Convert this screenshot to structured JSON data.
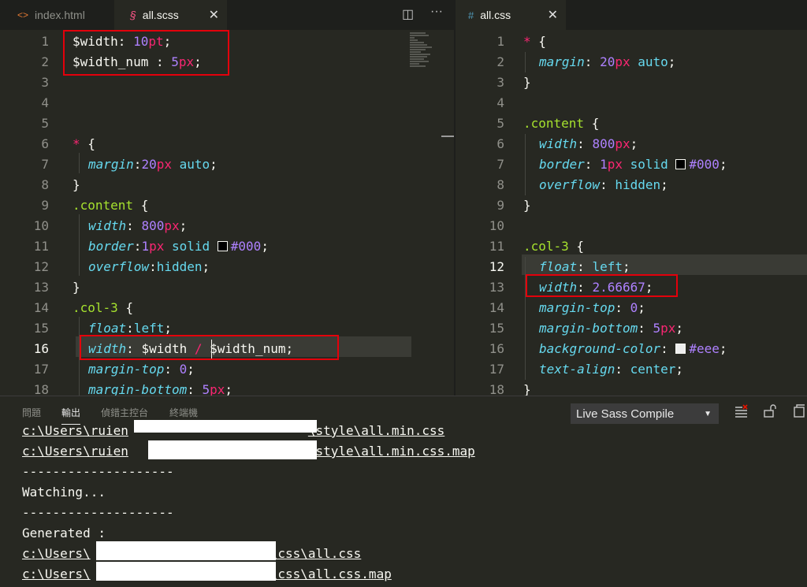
{
  "tabs_left": [
    {
      "icon": "<>",
      "label": "index.html"
    },
    {
      "icon": "§",
      "label": "all.scss",
      "close": "✕"
    }
  ],
  "tabs_right": [
    {
      "icon": "#",
      "label": "all.css",
      "close": "✕"
    }
  ],
  "toolbar": {
    "split_icon": "◫",
    "more_icon": "···"
  },
  "scss_lines": [
    "1",
    "2",
    "3",
    "4",
    "5",
    "6",
    "7",
    "8",
    "9",
    "10",
    "11",
    "12",
    "13",
    "14",
    "15",
    "16",
    "17",
    "18"
  ],
  "scss": {
    "l1": {
      "var": "$width",
      "sep": ": ",
      "num": "10",
      "unit": "pt",
      "end": ";"
    },
    "l2": {
      "var": "$width_num",
      "sep": " : ",
      "num": "5",
      "unit": "px",
      "end": ";"
    },
    "l6": {
      "sel": "*",
      "rest": " {"
    },
    "l7": {
      "prop": "margin",
      "colon": ":",
      "num": "20",
      "unit": "px",
      "val": " auto",
      "end": ";"
    },
    "l8": {
      "text": "}"
    },
    "l9": {
      "cls": ".content",
      "rest": " {"
    },
    "l10": {
      "prop": "width",
      "colon": ": ",
      "num": "800",
      "unit": "px",
      "end": ";"
    },
    "l11": {
      "prop": "border",
      "colon": ":",
      "num": "1",
      "unit": "px",
      "val": " solid ",
      "color": "#000",
      "end": ";"
    },
    "l12": {
      "prop": "overflow",
      "colon": ":",
      "val": "hidden",
      "end": ";"
    },
    "l13": {
      "text": "}"
    },
    "l14": {
      "cls": ".col-3",
      "rest": " {"
    },
    "l15": {
      "prop": "float",
      "colon": ":",
      "val": "left",
      "end": ";"
    },
    "l16": {
      "prop": "width",
      "colon": ": ",
      "var1": "$width",
      "op": " / ",
      "var2": "$width_num",
      "end": ";"
    },
    "l17": {
      "prop": "margin-top",
      "colon": ": ",
      "num": "0",
      "end": ";"
    },
    "l18": {
      "prop": "margin-bottom",
      "colon": ": ",
      "num": "5",
      "unit": "px",
      "end": ";"
    }
  },
  "css_lines": [
    "1",
    "2",
    "3",
    "4",
    "5",
    "6",
    "7",
    "8",
    "9",
    "10",
    "11",
    "12",
    "13",
    "14",
    "15",
    "16",
    "17",
    "18"
  ],
  "css": {
    "l1": {
      "sel": "*",
      "rest": " {"
    },
    "l2": {
      "prop": "margin",
      "colon": ": ",
      "num": "20",
      "unit": "px",
      "val": " auto",
      "end": ";"
    },
    "l3": {
      "text": "}"
    },
    "l5": {
      "cls": ".content",
      "rest": " {"
    },
    "l6": {
      "prop": "width",
      "colon": ": ",
      "num": "800",
      "unit": "px",
      "end": ";"
    },
    "l7": {
      "prop": "border",
      "colon": ": ",
      "num": "1",
      "unit": "px",
      "val": " solid ",
      "color": "#000",
      "end": ";"
    },
    "l8": {
      "prop": "overflow",
      "colon": ": ",
      "val": "hidden",
      "end": ";"
    },
    "l9": {
      "text": "}"
    },
    "l11": {
      "cls": ".col-3",
      "rest": " {"
    },
    "l12": {
      "prop": "float",
      "colon": ": ",
      "val": "left",
      "end": ";"
    },
    "l13": {
      "prop": "width",
      "colon": ": ",
      "num": "2.66667",
      "end": ";"
    },
    "l14": {
      "prop": "margin-top",
      "colon": ": ",
      "num": "0",
      "end": ";"
    },
    "l15": {
      "prop": "margin-bottom",
      "colon": ": ",
      "num": "5",
      "unit": "px",
      "end": ";"
    },
    "l16": {
      "prop": "background-color",
      "colon": ": ",
      "color": "#eee",
      "end": ";"
    },
    "l17": {
      "prop": "text-align",
      "colon": ": ",
      "val": "center",
      "end": ";"
    },
    "l18": {
      "text": "}"
    }
  },
  "panel": {
    "tabs": [
      "問題",
      "輸出",
      "偵錯主控台",
      "終端機"
    ],
    "dropdown_value": "Live Sass Compile",
    "dropdown_arrow": "▼",
    "output": [
      {
        "pre": "c:\\Users\\ruien",
        "post": "\\style\\all.min.css"
      },
      {
        "pre": "c:\\Users\\ruien",
        "post": "\\style\\all.min.css.map"
      },
      {
        "text": "--------------------"
      },
      {
        "text": "Watching..."
      },
      {
        "text": "--------------------"
      },
      {
        "text": "Generated :"
      },
      {
        "pre": "c:\\Users\\",
        "post": "\\css\\all.css"
      },
      {
        "pre": "c:\\Users\\",
        "post": "\\css\\all.css.map"
      }
    ]
  }
}
